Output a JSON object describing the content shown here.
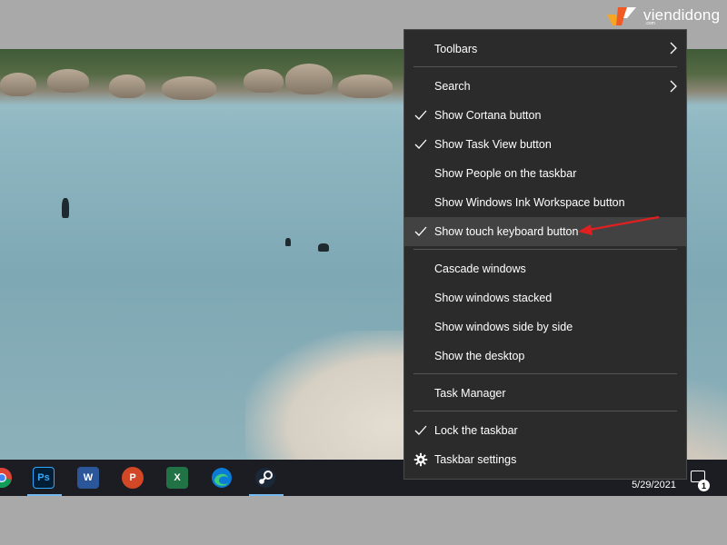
{
  "watermark": {
    "brand": "viendidong",
    "suffix": ".com"
  },
  "taskbar": {
    "apps": [
      {
        "name": "chrome"
      },
      {
        "name": "photoshop",
        "label": "Ps",
        "color": "#001e36",
        "text_color": "#31a8ff"
      },
      {
        "name": "word",
        "label": "W",
        "color": "#2b579a"
      },
      {
        "name": "powerpoint",
        "label": "P",
        "color": "#d24726"
      },
      {
        "name": "excel",
        "label": "X",
        "color": "#217346"
      },
      {
        "name": "edge"
      },
      {
        "name": "steam"
      }
    ],
    "date": "5/29/2021",
    "notification_count": "1"
  },
  "menu": {
    "items": [
      {
        "label": "Toolbars",
        "checked": false,
        "submenu": true
      },
      {
        "label": "Search",
        "checked": false,
        "submenu": true
      },
      {
        "label": "Show Cortana button",
        "checked": true
      },
      {
        "label": "Show Task View button",
        "checked": true
      },
      {
        "label": "Show People on the taskbar",
        "checked": false
      },
      {
        "label": "Show Windows Ink Workspace button",
        "checked": false
      },
      {
        "label": "Show touch keyboard button",
        "checked": true,
        "highlighted": true
      },
      {
        "label": "Cascade windows",
        "checked": false
      },
      {
        "label": "Show windows stacked",
        "checked": false
      },
      {
        "label": "Show windows side by side",
        "checked": false
      },
      {
        "label": "Show the desktop",
        "checked": false
      },
      {
        "label": "Task Manager",
        "checked": false
      },
      {
        "label": "Lock the taskbar",
        "checked": true
      },
      {
        "label": "Taskbar settings",
        "checked": false,
        "icon": "gear-icon"
      }
    ]
  },
  "annotation": {
    "color": "#e02020"
  },
  "colors": {
    "menu_bg": "#2b2b2b",
    "menu_highlight": "#424242",
    "taskbar_bg": "#1b1d22"
  }
}
